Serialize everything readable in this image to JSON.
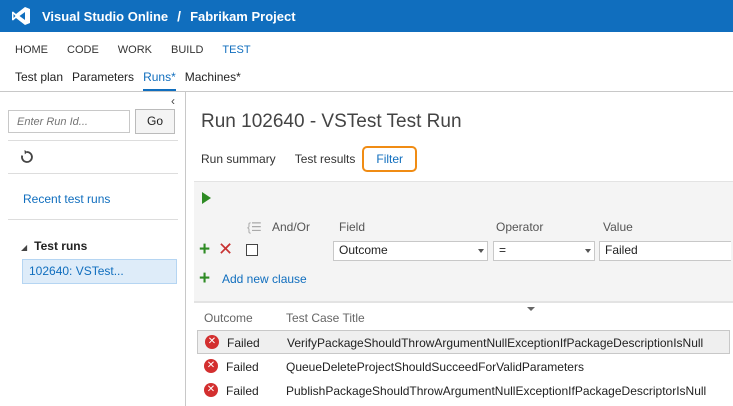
{
  "topbar": {
    "brand": "Visual Studio Online",
    "separator": "/",
    "project": "Fabrikam Project"
  },
  "hub_nav": [
    "HOME",
    "CODE",
    "WORK",
    "BUILD",
    "TEST"
  ],
  "hub_nav_active": "TEST",
  "sub_nav": [
    "Test plan",
    "Parameters",
    "Runs*",
    "Machines*"
  ],
  "sub_nav_active": "Runs*",
  "left_pane": {
    "collapse_glyph": "‹",
    "run_id_placeholder": "Enter Run Id...",
    "go_label": "Go",
    "recent_link": "Recent test runs",
    "tree_header": "Test runs",
    "tree_item": "102640: VSTest..."
  },
  "run": {
    "title": "Run 102640 - VSTest Test Run",
    "tabs": [
      "Run summary",
      "Test results",
      "Filter"
    ],
    "active_tab": "Filter"
  },
  "filter": {
    "headers": {
      "and_or": "And/Or",
      "field": "Field",
      "operator": "Operator",
      "value": "Value"
    },
    "clause": {
      "field": "Outcome",
      "operator": "=",
      "value": "Failed"
    },
    "add_clause_label": "Add new clause"
  },
  "grid": {
    "headers": {
      "outcome": "Outcome",
      "title": "Test Case Title"
    },
    "rows": [
      {
        "outcome": "Failed",
        "title": "VerifyPackageShouldThrowArgumentNullExceptionIfPackageDescriptionIsNull",
        "selected": true
      },
      {
        "outcome": "Failed",
        "title": "QueueDeleteProjectShouldSucceedForValidParameters",
        "selected": false
      },
      {
        "outcome": "Failed",
        "title": "PublishPackageShouldThrowArgumentNullExceptionIfPackageDescriptorIsNull",
        "selected": false
      }
    ]
  },
  "colors": {
    "accent": "#106ebe",
    "highlight": "#f08c14",
    "success": "#2e8b24",
    "error": "#d32f2f"
  },
  "icons": [
    "visual-studio-logo-icon",
    "collapse-icon",
    "refresh-icon",
    "run-icon",
    "group-icon",
    "add-icon",
    "delete-icon",
    "error-icon",
    "sort-icon"
  ]
}
